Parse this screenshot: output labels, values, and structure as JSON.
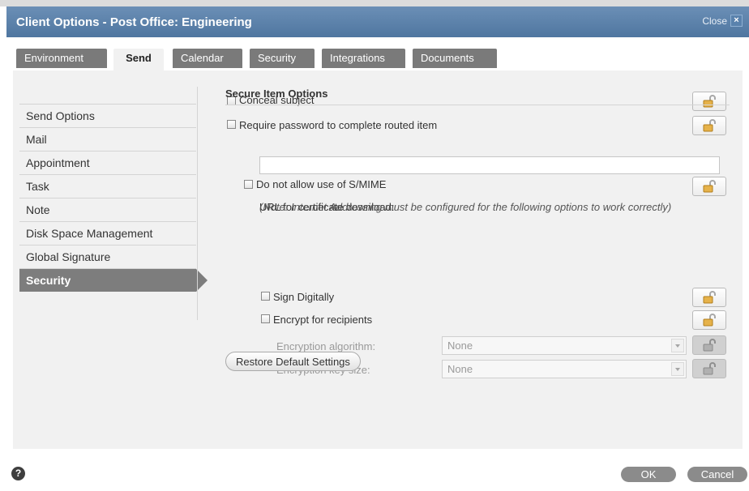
{
  "dialog": {
    "title": "Client Options - Post Office: Engineering",
    "close_label": "Close",
    "close_glyph": "×"
  },
  "tabs": [
    {
      "label": "Environment",
      "active": false
    },
    {
      "label": "Send",
      "active": true
    },
    {
      "label": "Calendar",
      "active": false
    },
    {
      "label": "Security",
      "active": false
    },
    {
      "label": "Integrations",
      "active": false
    },
    {
      "label": "Documents",
      "active": false
    }
  ],
  "sidebar": {
    "items": [
      {
        "label": "Send Options",
        "active": false
      },
      {
        "label": "Mail",
        "active": false
      },
      {
        "label": "Appointment",
        "active": false
      },
      {
        "label": "Task",
        "active": false
      },
      {
        "label": "Note",
        "active": false
      },
      {
        "label": "Disk Space Management",
        "active": false
      },
      {
        "label": "Global Signature",
        "active": false
      },
      {
        "label": "Security",
        "active": true
      }
    ]
  },
  "options": {
    "conceal_subject": {
      "label": "Conceal subject",
      "checked": false
    },
    "require_password": {
      "label": "Require password to complete routed item",
      "checked": false
    },
    "section_heading": "Secure Item Options",
    "no_smime": {
      "label": "Do not allow use of S/MIME",
      "checked": false
    },
    "url_label": "URL for certificate download:",
    "url_value": "",
    "note": "(Note: Internet Addressing must be configured for the following options to work correctly)",
    "sign_digitally": {
      "label": "Sign Digitally",
      "checked": false
    },
    "encrypt": {
      "label": "Encrypt for recipients",
      "checked": false
    },
    "encryption_algorithm": {
      "label": "Encryption algorithm:",
      "value": "None"
    },
    "encryption_key_size": {
      "label": "Encryption key size:",
      "value": "None"
    }
  },
  "buttons": {
    "restore": "Restore Default Settings",
    "ok": "OK",
    "cancel": "Cancel",
    "help": "?"
  },
  "icons": {
    "lock": "lock-open-icon",
    "help": "help-icon",
    "close": "close-icon",
    "dropdown": "chevron-down-icon"
  },
  "colors": {
    "titlebar": "#5b81aa",
    "active_item": "#7d7d7d",
    "lock_shackle": "#a8a8a8",
    "lock_body": "#e6b24a"
  }
}
